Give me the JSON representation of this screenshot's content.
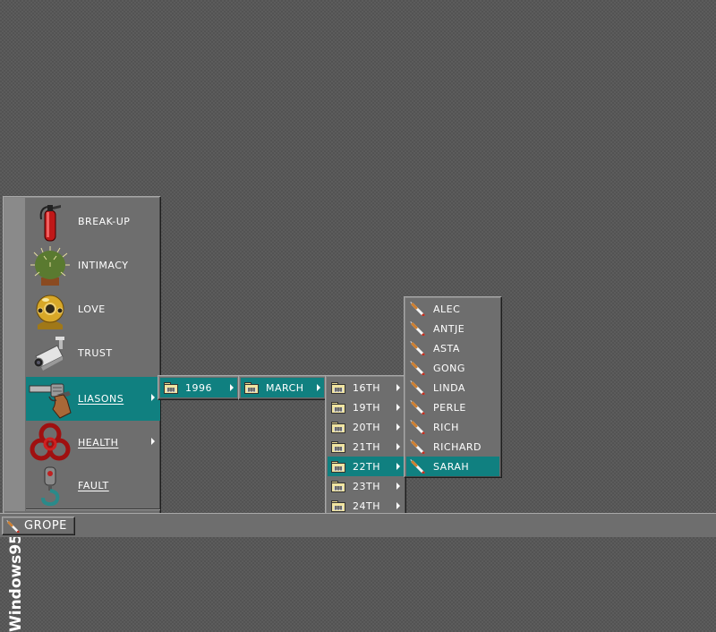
{
  "start_menu": {
    "brand": "Windows95",
    "items": [
      {
        "label": "Break-up",
        "icon": "fire-extinguisher-icon",
        "has_submenu": false,
        "active": false
      },
      {
        "label": "Intimacy",
        "icon": "cactus-icon",
        "has_submenu": false,
        "active": false
      },
      {
        "label": "Love",
        "icon": "diving-helmet-icon",
        "has_submenu": false,
        "active": false
      },
      {
        "label": "Trust",
        "icon": "security-camera-icon",
        "has_submenu": false,
        "active": false
      },
      {
        "label": "Liasons",
        "icon": "revolver-icon",
        "has_submenu": true,
        "active": true
      },
      {
        "label": "Health",
        "icon": "biohazard-icon",
        "has_submenu": true,
        "active": false
      },
      {
        "label": "Fault",
        "icon": "crane-hook-icon",
        "has_submenu": false,
        "active": false
      }
    ]
  },
  "submenu_years": {
    "items": [
      {
        "label": "1996",
        "icon": "folder-icon",
        "active": true
      }
    ]
  },
  "submenu_months": {
    "items": [
      {
        "label": "March",
        "icon": "folder-icon",
        "active": true
      }
    ]
  },
  "submenu_days": {
    "items": [
      {
        "label": "16th",
        "icon": "folder-icon",
        "active": false
      },
      {
        "label": "19th",
        "icon": "folder-icon",
        "active": false
      },
      {
        "label": "20th",
        "icon": "folder-icon",
        "active": false
      },
      {
        "label": "21th",
        "icon": "folder-icon",
        "active": false
      },
      {
        "label": "22th",
        "icon": "folder-icon",
        "active": true
      },
      {
        "label": "23th",
        "icon": "folder-icon",
        "active": false
      },
      {
        "label": "24th",
        "icon": "folder-icon",
        "active": false
      }
    ]
  },
  "submenu_people": {
    "items": [
      {
        "label": "Alec",
        "icon": "cigarette-icon",
        "active": false
      },
      {
        "label": "antje",
        "icon": "cigarette-icon",
        "active": false
      },
      {
        "label": "Asta",
        "icon": "cigarette-icon",
        "active": false
      },
      {
        "label": "gong",
        "icon": "cigarette-icon",
        "active": false
      },
      {
        "label": "linda",
        "icon": "cigarette-icon",
        "active": false
      },
      {
        "label": "perle",
        "icon": "cigarette-icon",
        "active": false
      },
      {
        "label": "rich",
        "icon": "cigarette-icon",
        "active": false
      },
      {
        "label": "Richard",
        "icon": "cigarette-icon",
        "active": false
      },
      {
        "label": "sarah",
        "icon": "cigarette-icon",
        "active": true
      }
    ]
  },
  "taskbar": {
    "start_label": "Grope",
    "start_icon": "cigarette-icon"
  },
  "colors": {
    "highlight": "#108080",
    "face": "#6e6e6e",
    "desktop": "#5c5c5c"
  }
}
